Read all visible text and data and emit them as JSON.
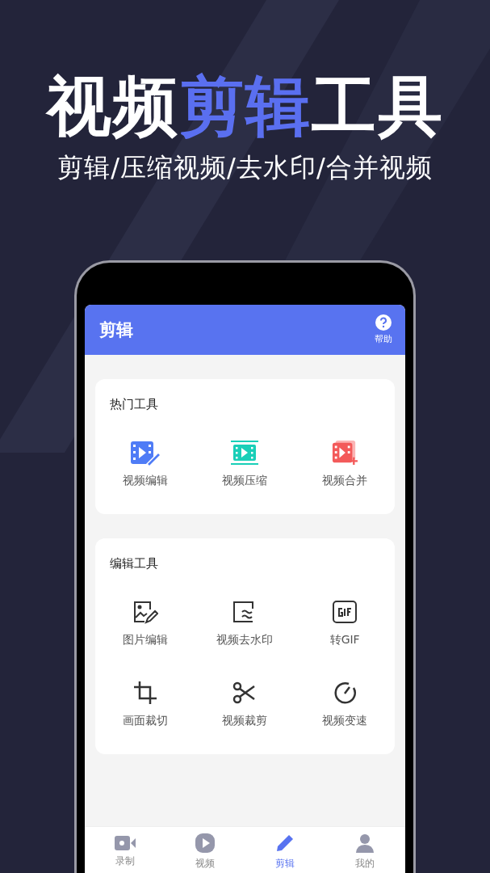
{
  "headline": [
    {
      "text": "视频",
      "accent": false
    },
    {
      "text": "剪辑",
      "accent": true
    },
    {
      "text": "工具",
      "accent": false
    }
  ],
  "subtitle": "剪辑/压缩视频/去水印/合并视频",
  "app_bar": {
    "title": "剪辑",
    "help_label": "帮助"
  },
  "sections": [
    {
      "title": "热门工具",
      "tools": [
        {
          "label": "视频编辑",
          "kind": "video-edit"
        },
        {
          "label": "视频压缩",
          "kind": "video-compress"
        },
        {
          "label": "视频合并",
          "kind": "video-merge"
        }
      ]
    },
    {
      "title": "编辑工具",
      "tools": [
        {
          "label": "图片编辑",
          "kind": "image-edit"
        },
        {
          "label": "视频去水印",
          "kind": "watermark"
        },
        {
          "label": "转GIF",
          "kind": "gif"
        },
        {
          "label": "画面裁切",
          "kind": "crop"
        },
        {
          "label": "视频裁剪",
          "kind": "scissors"
        },
        {
          "label": "视频变速",
          "kind": "speed"
        }
      ]
    }
  ],
  "tab_bar": [
    {
      "label": "录制",
      "kind": "record",
      "selected": false
    },
    {
      "label": "视频",
      "kind": "video",
      "selected": false
    },
    {
      "label": "剪辑",
      "kind": "edit",
      "selected": true
    },
    {
      "label": "我的",
      "kind": "profile",
      "selected": false
    }
  ]
}
